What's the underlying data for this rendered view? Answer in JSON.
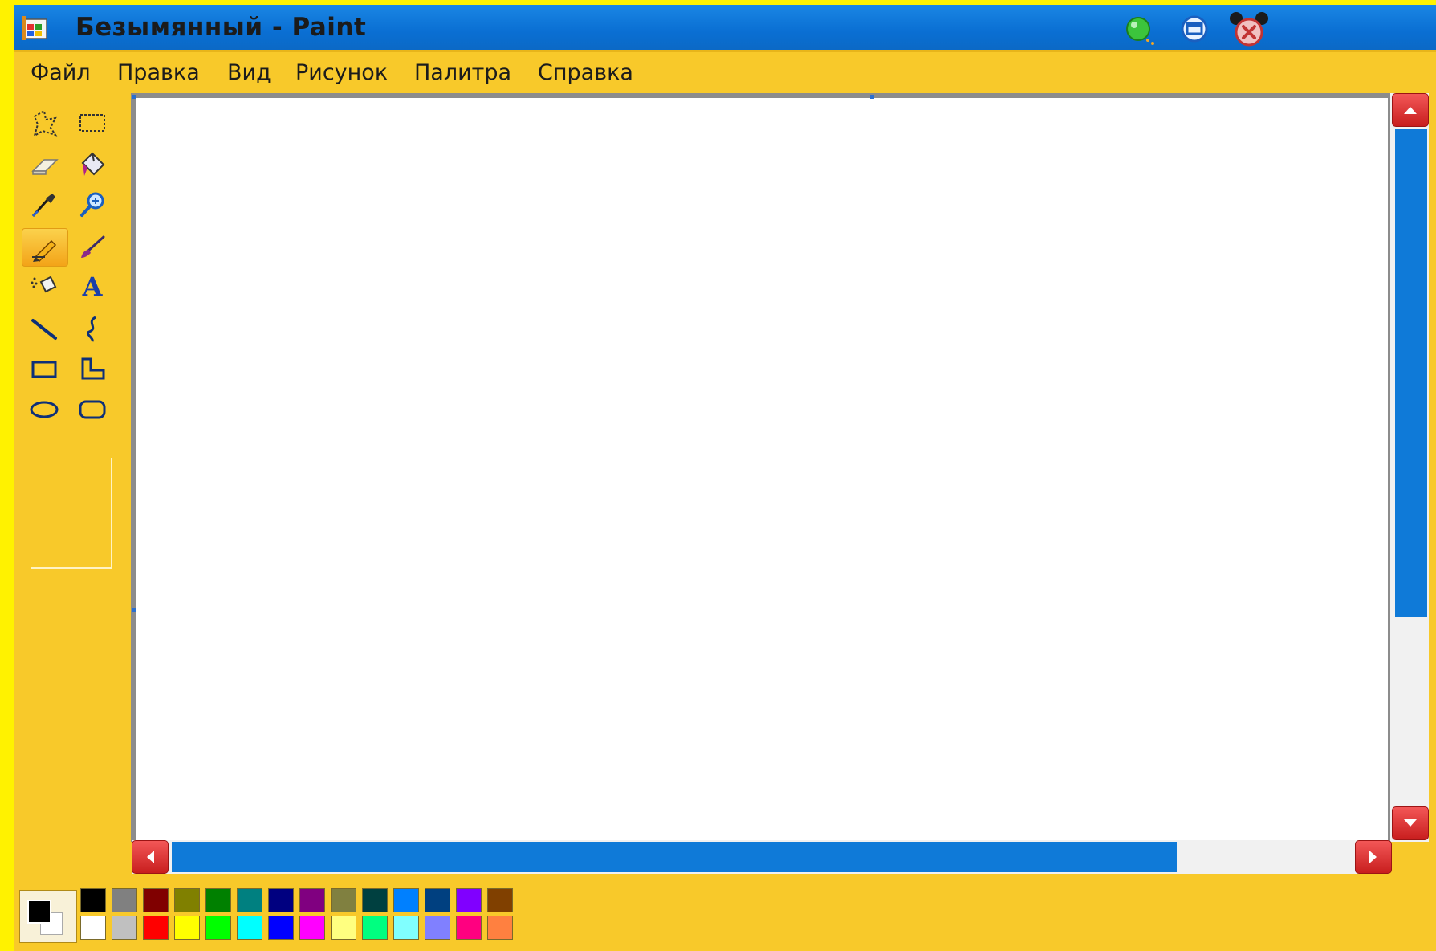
{
  "window": {
    "title": "Безымянный - Paint"
  },
  "menu": [
    "Файл",
    "Правка",
    "Вид",
    "Рисунок",
    "Палитра",
    "Справка"
  ],
  "tools": [
    {
      "name": "free-form-select",
      "icon": "free-select-icon"
    },
    {
      "name": "rect-select",
      "icon": "rect-select-icon"
    },
    {
      "name": "eraser",
      "icon": "eraser-icon"
    },
    {
      "name": "fill",
      "icon": "paint-bucket-icon"
    },
    {
      "name": "pick-color",
      "icon": "eyedropper-icon"
    },
    {
      "name": "magnifier",
      "icon": "magnifier-icon"
    },
    {
      "name": "pencil",
      "icon": "pencil-icon",
      "selected": true
    },
    {
      "name": "brush",
      "icon": "brush-icon"
    },
    {
      "name": "airbrush",
      "icon": "airbrush-icon"
    },
    {
      "name": "text",
      "icon": "text-icon",
      "glyph": "A"
    },
    {
      "name": "line",
      "icon": "line-icon"
    },
    {
      "name": "curve",
      "icon": "curve-icon"
    },
    {
      "name": "rectangle",
      "icon": "rectangle-icon"
    },
    {
      "name": "polygon",
      "icon": "polygon-icon"
    },
    {
      "name": "ellipse",
      "icon": "ellipse-icon"
    },
    {
      "name": "rounded-rectangle",
      "icon": "rounded-rect-icon"
    }
  ],
  "palette": {
    "foreground": "#000000",
    "background": "#ffffff",
    "top_row": [
      "#000000",
      "#808080",
      "#800000",
      "#808000",
      "#008000",
      "#008080",
      "#000080",
      "#800080",
      "#808040",
      "#004040",
      "#0080ff",
      "#004080",
      "#8000ff",
      "#804000"
    ],
    "bottom_row": [
      "#ffffff",
      "#c0c0c0",
      "#ff0000",
      "#ffff00",
      "#00ff00",
      "#00ffff",
      "#0000ff",
      "#ff00ff",
      "#ffff80",
      "#00ff80",
      "#80ffff",
      "#8080ff",
      "#ff0080",
      "#ff8040"
    ]
  },
  "colors": {
    "accent_blue": "#0f7ad8",
    "chrome_yellow": "#f8c92a",
    "scroll_button_red": "#d92a2a"
  }
}
